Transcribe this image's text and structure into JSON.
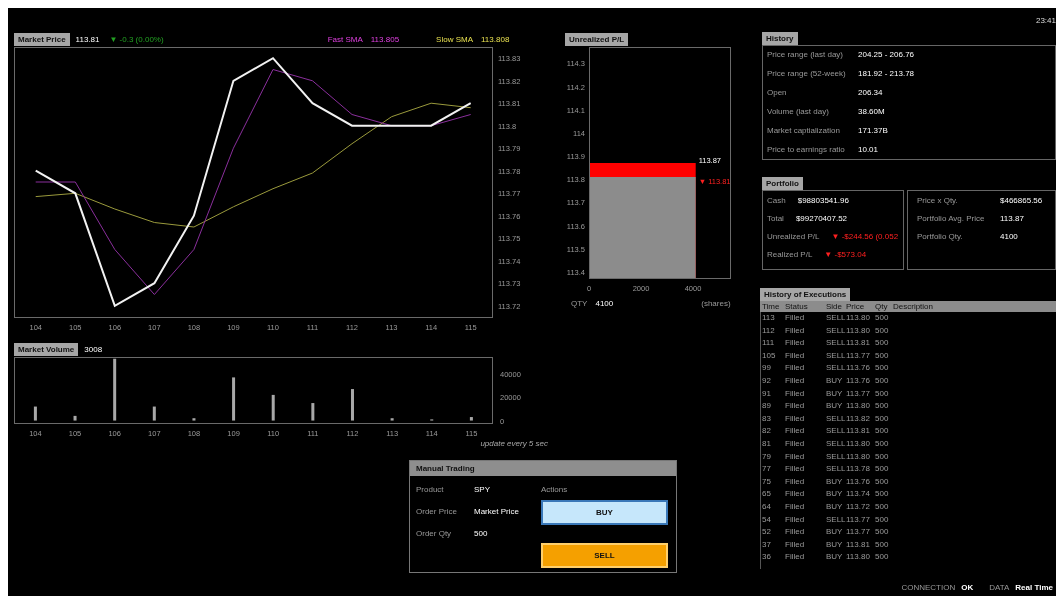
{
  "clock": "23:41",
  "market_price": {
    "title": "Market Price",
    "value": "113.81",
    "change": "▼ -0.3 (0.00%)",
    "fast_sma": {
      "value": "113.805"
    },
    "slow_sma": {
      "value": "113.808"
    },
    "chart_data": {
      "type": "line",
      "x": [
        104,
        105,
        106,
        107,
        108,
        109,
        110,
        111,
        112,
        113,
        114,
        115
      ],
      "xlim": [
        103.45,
        115.54
      ],
      "ylim": [
        113.715,
        113.835
      ],
      "xticks": [
        104,
        105,
        106,
        107,
        108,
        109,
        110,
        111,
        112,
        113,
        114,
        115
      ],
      "yticks": [
        113.72,
        113.73,
        113.74,
        113.75,
        113.76,
        113.77,
        113.78,
        113.79,
        113.8,
        113.81,
        113.82,
        113.83
      ],
      "series": [
        {
          "name": "Slow SMA",
          "color": "#9a9a3c",
          "values": [
            113.7685,
            113.77,
            113.763,
            113.757,
            113.755,
            113.764,
            113.772,
            113.779,
            113.792,
            113.804,
            113.81,
            113.808
          ]
        },
        {
          "name": "Fast SMA",
          "color": "#8a2f9c",
          "values": [
            113.775,
            113.775,
            113.745,
            113.725,
            113.745,
            113.79,
            113.825,
            113.82,
            113.805,
            113.8,
            113.8,
            113.805
          ]
        },
        {
          "color": "#f2f2f2",
          "values": [
            113.78,
            113.77,
            113.72,
            113.73,
            113.76,
            113.82,
            113.83,
            113.81,
            113.8,
            113.8,
            113.8,
            113.81
          ]
        }
      ]
    }
  },
  "market_volume": {
    "title": "Market Volume",
    "value": "3008",
    "note": "update every 5 sec",
    "chart_data": {
      "type": "bar",
      "x": [
        104,
        105,
        106,
        107,
        108,
        109,
        110,
        111,
        112,
        113,
        114,
        115
      ],
      "values": [
        12000,
        4000,
        53000,
        12000,
        2000,
        37000,
        22000,
        15000,
        27000,
        2000,
        1000,
        3000
      ],
      "xlim": [
        103.46,
        115.52
      ],
      "ylim": [
        -2100,
        54500
      ],
      "xticks": [
        104,
        105,
        106,
        107,
        108,
        109,
        110,
        111,
        112,
        113,
        114,
        115
      ],
      "yticks": [
        0,
        20000,
        40000
      ]
    }
  },
  "unrealized_pl": {
    "title": "Unrealized P/L",
    "qty_label": "QTY",
    "qty": "4100",
    "unit": "(shares)",
    "avg_price_label": "113.87",
    "market_price_label": "▼ 113.81",
    "chart_data": {
      "type": "area",
      "x": [
        0,
        4100
      ],
      "xlim": [
        0,
        5420
      ],
      "ylim": [
        113.374,
        114.371
      ],
      "xticks": [
        0,
        2000,
        4000
      ],
      "yticks": [
        113.4,
        113.5,
        113.6,
        113.7,
        113.8,
        113.9,
        114,
        114.1,
        114.2,
        114.3
      ],
      "series": [
        {
          "color": "#ff0000",
          "values": [
            113.87,
            113.87
          ]
        },
        {
          "color": "#8c8c8c",
          "values": [
            113.81,
            113.81
          ]
        }
      ]
    }
  },
  "history": {
    "title": "History",
    "rows": [
      {
        "label": "Price range (last day)",
        "value": "204.25 - 206.76"
      },
      {
        "label": "Price range (52-week)",
        "value": "181.92 - 213.78"
      },
      {
        "label": "Open",
        "value": "206.34"
      },
      {
        "label": "Volume (last day)",
        "value": "38.60M"
      },
      {
        "label": "Market captialization",
        "value": "171.37B"
      },
      {
        "label": "Price to earnings ratio",
        "value": "10.01"
      }
    ]
  },
  "portfolio": {
    "title": "Portfolio",
    "left": [
      {
        "label": "Cash",
        "value": "$98803541.96",
        "negative": false
      },
      {
        "label": "Total",
        "value": "$99270407.52",
        "negative": false
      },
      {
        "label": "Unrealized P/L",
        "value": "▼ -$244.56 (0.052",
        "negative": true
      },
      {
        "label": "Realized P/L",
        "value": "▼ -$573.04",
        "negative": true
      }
    ],
    "right": [
      {
        "label": "Price x Qty.",
        "value": "$466865.56"
      },
      {
        "label": "Portfolio Avg. Price",
        "value": "113.87"
      },
      {
        "label": "Portfolio Qty.",
        "value": "4100"
      }
    ]
  },
  "executions": {
    "title": "History of Executions",
    "columns": [
      "Time",
      "Status",
      "Side",
      "Price",
      "Qty",
      "Description"
    ],
    "rows": [
      [
        "113",
        "Filled",
        "SELL",
        "113.80",
        "500"
      ],
      [
        "112",
        "Filled",
        "SELL",
        "113.80",
        "500"
      ],
      [
        "111",
        "Filled",
        "SELL",
        "113.81",
        "500"
      ],
      [
        "105",
        "Filled",
        "SELL",
        "113.77",
        "500"
      ],
      [
        "99",
        "Filled",
        "SELL",
        "113.76",
        "500"
      ],
      [
        "92",
        "Filled",
        "BUY",
        "113.76",
        "500"
      ],
      [
        "91",
        "Filled",
        "BUY",
        "113.77",
        "500"
      ],
      [
        "89",
        "Filled",
        "BUY",
        "113.80",
        "500"
      ],
      [
        "83",
        "Filled",
        "SELL",
        "113.82",
        "500"
      ],
      [
        "82",
        "Filled",
        "SELL",
        "113.81",
        "500"
      ],
      [
        "81",
        "Filled",
        "SELL",
        "113.80",
        "500"
      ],
      [
        "79",
        "Filled",
        "SELL",
        "113.80",
        "500"
      ],
      [
        "77",
        "Filled",
        "SELL",
        "113.78",
        "500"
      ],
      [
        "75",
        "Filled",
        "BUY",
        "113.76",
        "500"
      ],
      [
        "65",
        "Filled",
        "BUY",
        "113.74",
        "500"
      ],
      [
        "64",
        "Filled",
        "BUY",
        "113.72",
        "500"
      ],
      [
        "54",
        "Filled",
        "SELL",
        "113.77",
        "500"
      ],
      [
        "52",
        "Filled",
        "BUY",
        "113.77",
        "500"
      ],
      [
        "37",
        "Filled",
        "BUY",
        "113.81",
        "500"
      ],
      [
        "36",
        "Filled",
        "BUY",
        "113.80",
        "500"
      ]
    ]
  },
  "manual_trading": {
    "title": "Manual Trading",
    "fields": [
      {
        "label": "Product",
        "value": "SPY"
      },
      {
        "label": "Order Price",
        "value": "Market Price"
      },
      {
        "label": "Order Qty",
        "value": "500"
      }
    ],
    "actions_label": "Actions",
    "buttons": [
      {
        "label": "BUY",
        "kind": "buy"
      },
      {
        "label": "SELL",
        "kind": "sell"
      }
    ]
  },
  "status_bar": [
    {
      "label": "CONNECTION",
      "value": "OK"
    },
    {
      "label": "DATA",
      "value": "Real Time"
    }
  ]
}
